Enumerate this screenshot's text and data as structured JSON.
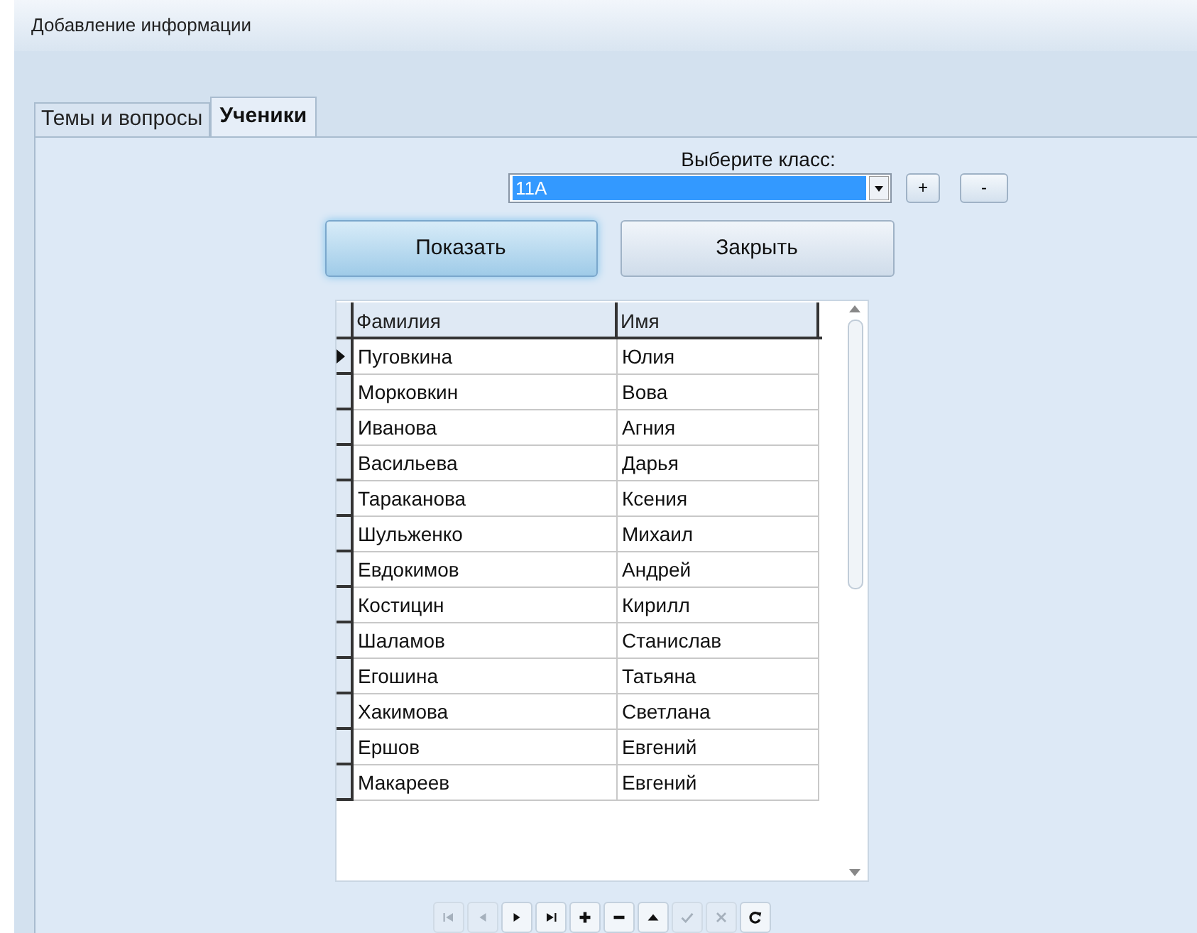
{
  "window": {
    "title": "Добавление информации"
  },
  "tabs": [
    {
      "label": "Темы и вопросы",
      "selected": false
    },
    {
      "label": "Ученики",
      "selected": true
    }
  ],
  "class_label": "Выберите класс:",
  "class_select": {
    "value": "11А"
  },
  "add_button": "+",
  "remove_button": "-",
  "buttons": [
    {
      "label": "Показать",
      "focused": true
    },
    {
      "label": "Закрыть",
      "focused": false
    }
  ],
  "table": {
    "columns": [
      "Фамилия",
      "Имя"
    ],
    "rows": [
      {
        "cells": [
          "Пуговкина",
          "Юлия"
        ],
        "selected": true
      },
      {
        "cells": [
          "Морковкин",
          "Вова"
        ],
        "selected": false
      },
      {
        "cells": [
          "Иванова",
          "Агния"
        ],
        "selected": false
      },
      {
        "cells": [
          "Васильева",
          "Дарья"
        ],
        "selected": false
      },
      {
        "cells": [
          "Тараканова",
          "Ксения"
        ],
        "selected": false
      },
      {
        "cells": [
          "Шульженко",
          "Михаил"
        ],
        "selected": false
      },
      {
        "cells": [
          "Евдокимов",
          "Андрей"
        ],
        "selected": false
      },
      {
        "cells": [
          "Костицин",
          "Кирилл"
        ],
        "selected": false
      },
      {
        "cells": [
          "Шаламов",
          "Станислав"
        ],
        "selected": false
      },
      {
        "cells": [
          "Егошина",
          "Татьяна"
        ],
        "selected": false
      },
      {
        "cells": [
          "Хакимова",
          "Светлана"
        ],
        "selected": false
      },
      {
        "cells": [
          "Ершов",
          "Евгений"
        ],
        "selected": false
      },
      {
        "cells": [
          "Макареев",
          "Евгений"
        ],
        "selected": false
      }
    ]
  },
  "navigator": [
    {
      "kind": "first",
      "disabled": true
    },
    {
      "kind": "prior",
      "disabled": true
    },
    {
      "kind": "next",
      "disabled": false
    },
    {
      "kind": "last",
      "disabled": false
    },
    {
      "kind": "insert",
      "disabled": false
    },
    {
      "kind": "delete",
      "disabled": false
    },
    {
      "kind": "edit",
      "disabled": false
    },
    {
      "kind": "post",
      "disabled": true
    },
    {
      "kind": "cancel",
      "disabled": true
    },
    {
      "kind": "refresh",
      "disabled": false
    }
  ]
}
